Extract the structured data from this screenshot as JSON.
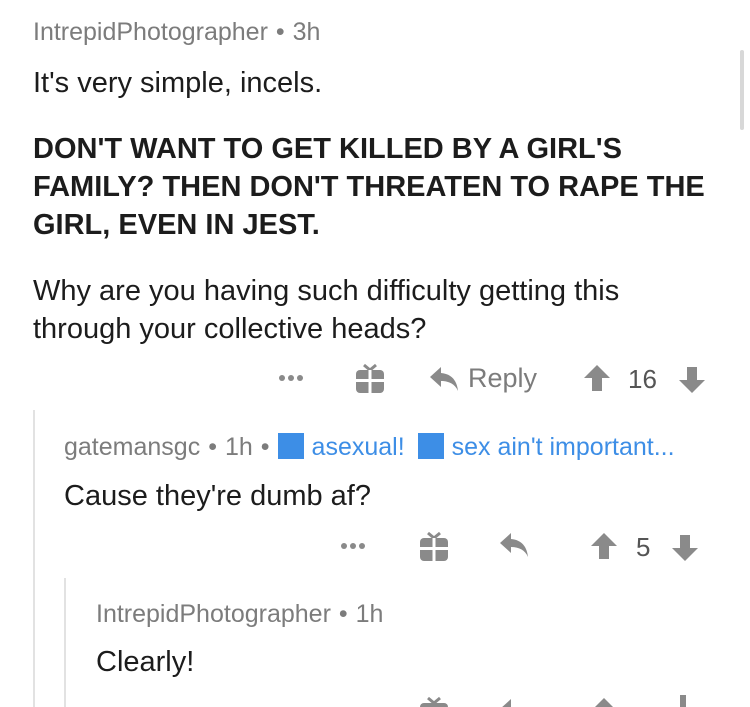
{
  "comments": [
    {
      "author": "IntrepidPhotographer",
      "time": "3h",
      "text": "It's very simple, incels.",
      "bold_text": "DON'T WANT TO GET KILLED BY A GIRL'S FAMILY? THEN DON'T THREATEN TO RAPE THE GIRL, EVEN IN JEST.",
      "text2": "Why are you having such difficulty getting this through your collective heads?",
      "reply_label": "Reply",
      "votes": "16"
    },
    {
      "author": "gatemansgc",
      "time": "1h",
      "flair1": "asexual!",
      "flair2": "sex ain't important...",
      "text": "Cause they're dumb af?",
      "votes": "5"
    },
    {
      "author": "IntrepidPhotographer",
      "time": "1h",
      "text": "Clearly!"
    }
  ],
  "icons": {
    "more": "more-options-icon",
    "gift": "gift-icon",
    "reply": "reply-arrow-icon",
    "upvote": "upvote-arrow-icon",
    "downvote": "downvote-arrow-icon"
  },
  "colors": {
    "meta": "#7c7c7c",
    "flair": "#3d8ee6",
    "thread_line": "#e2e2e2"
  }
}
